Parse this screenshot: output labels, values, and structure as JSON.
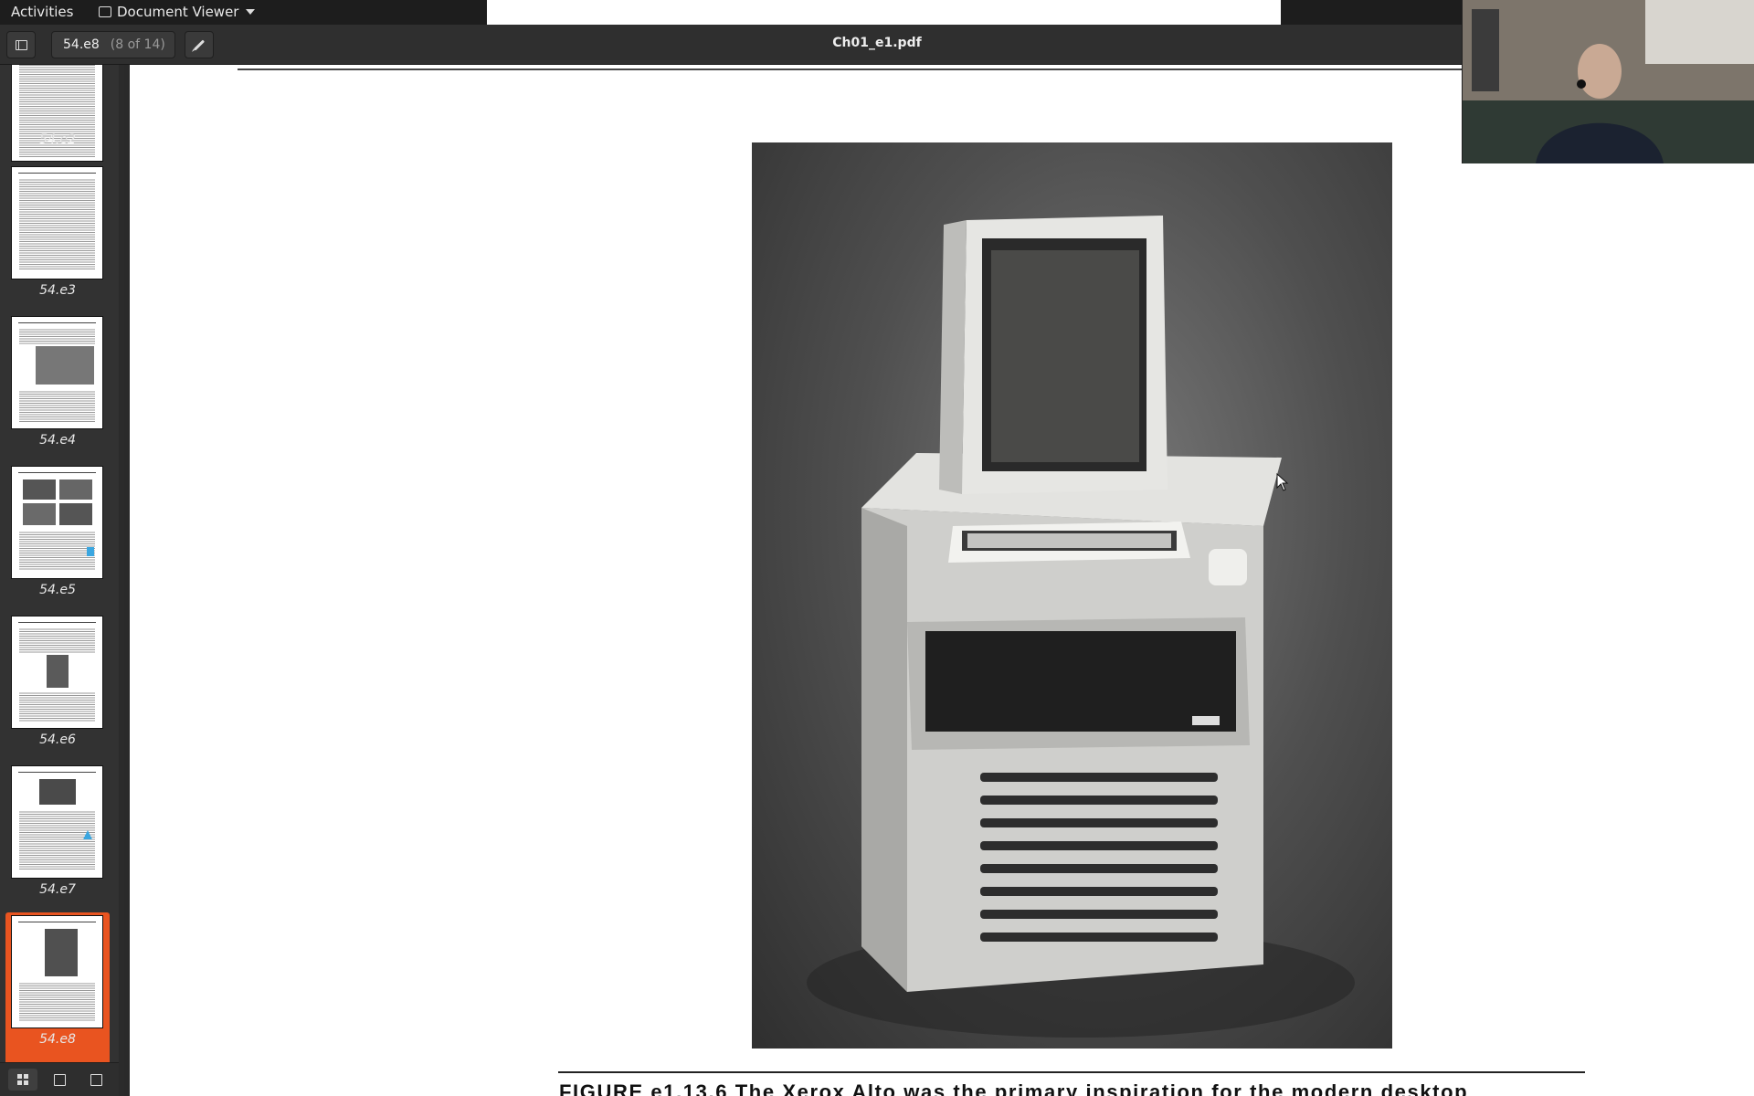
{
  "topbar": {
    "activities": "Activities",
    "app_name": "Document Viewer"
  },
  "header": {
    "page_label": "54.e8",
    "page_count": "(8 of 14)",
    "document_title": "Ch01_e1.pdf"
  },
  "sidebar": {
    "thumbnails": [
      {
        "label": "54.e2",
        "selected": false
      },
      {
        "label": "54.e3",
        "selected": false
      },
      {
        "label": "54.e4",
        "selected": false
      },
      {
        "label": "54.e5",
        "selected": false
      },
      {
        "label": "54.e6",
        "selected": false
      },
      {
        "label": "54.e7",
        "selected": false
      },
      {
        "label": "54.e8",
        "selected": true
      }
    ],
    "selection_color": "#e95420"
  },
  "document": {
    "caption": "FIGURE e1.13.6 The Xerox Alto was the primary inspiration for the modern desktop"
  },
  "icons": {
    "sidebar_toggle": "sidebar-toggle-icon",
    "annotate": "pencil-icon",
    "thumbnails_tab": "grid-icon",
    "annotations_tab": "annotation-icon",
    "bookmarks_tab": "bookmark-icon"
  }
}
